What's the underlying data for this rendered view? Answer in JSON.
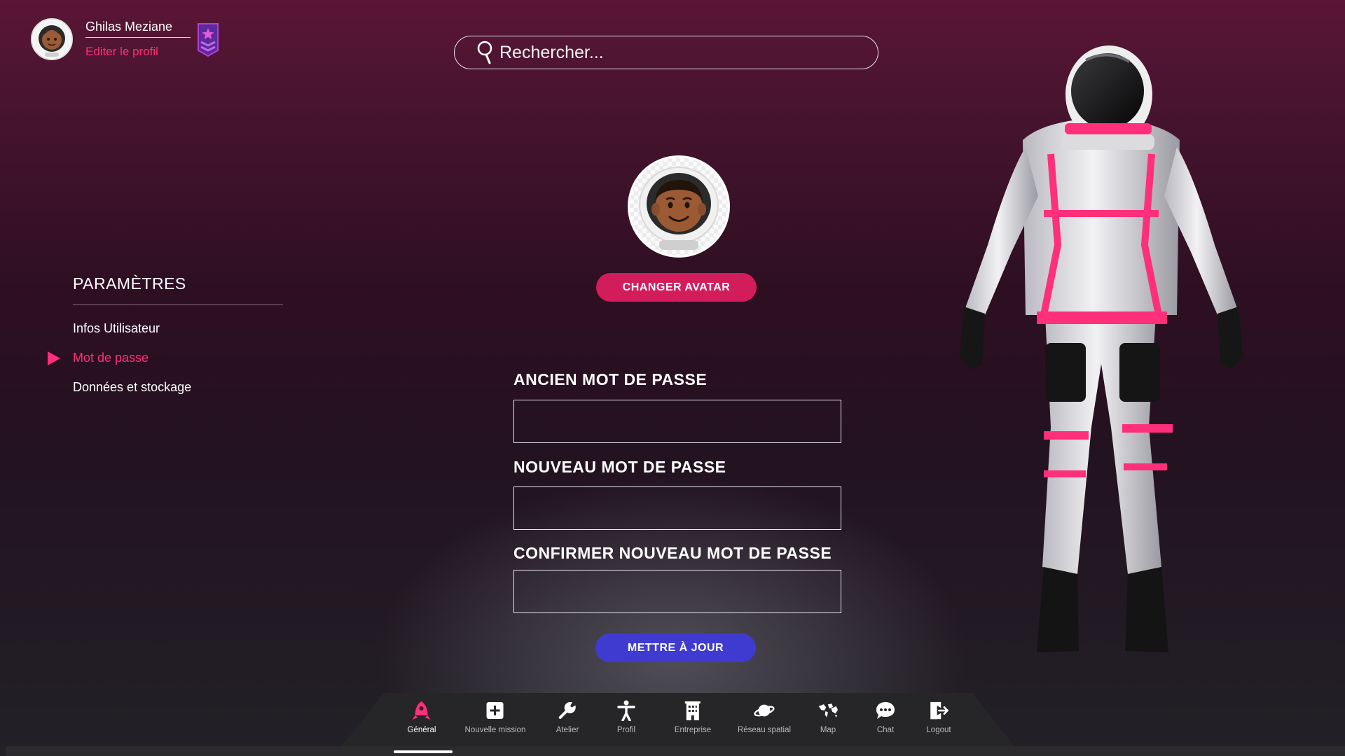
{
  "user": {
    "name": "Ghilas Meziane",
    "edit_profile": "Editer le profil",
    "avatar_icon": "astronaut-avatar-icon",
    "badge_icon": "rank-badge-icon"
  },
  "search": {
    "placeholder": "Rechercher..."
  },
  "settings": {
    "title": "PARAMÈTRES",
    "items": [
      {
        "label": "Infos Utilisateur",
        "active": false
      },
      {
        "label": "Mot de passe",
        "active": true
      },
      {
        "label": "Données et stockage",
        "active": false
      }
    ]
  },
  "profile": {
    "change_avatar": "CHANGER AVATAR"
  },
  "form": {
    "old_password_label": "ANCIEN MOT DE PASSE",
    "old_password_value": "",
    "new_password_label": "NOUVEAU MOT DE PASSE",
    "new_password_value": "",
    "confirm_password_label": "CONFIRMER NOUVEAU MOT DE PASSE",
    "confirm_password_value": "",
    "submit": "METTRE À JOUR"
  },
  "nav": {
    "active": "Général",
    "items": [
      {
        "label": "Général",
        "icon": "rocket-icon"
      },
      {
        "label": "Nouvelle mission",
        "icon": "plus-square-icon"
      },
      {
        "label": "Atelier",
        "icon": "wrench-icon"
      },
      {
        "label": "Profil",
        "icon": "person-icon"
      },
      {
        "label": "Entreprise",
        "icon": "building-icon"
      },
      {
        "label": "Réseau spatial",
        "icon": "planet-icon"
      },
      {
        "label": "Map",
        "icon": "world-map-icon"
      },
      {
        "label": "Chat",
        "icon": "chat-bubble-icon"
      },
      {
        "label": "Logout",
        "icon": "logout-icon"
      }
    ]
  },
  "colors": {
    "accent_pink": "#ff2f7a",
    "button_pink": "#d31c5a",
    "button_blue": "#3f3bd1",
    "background_top": "#5a1634",
    "background_bottom": "#222126"
  }
}
